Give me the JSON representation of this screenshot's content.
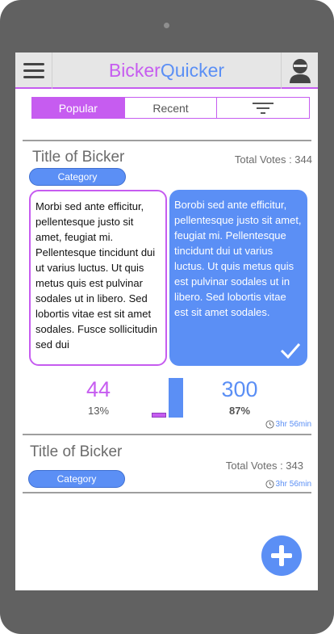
{
  "app": {
    "title_part1": "Bicker",
    "title_part2": "Quicker",
    "icons": {
      "menu": "hamburger-menu-icon",
      "profile": "user-avatar-icon",
      "filter": "filter-icon",
      "add": "plus-icon",
      "check": "checkmark-icon",
      "clock": "clock-icon"
    },
    "colors": {
      "purple": "#c65cf0",
      "blue": "#5b8ff5"
    }
  },
  "tabs": [
    {
      "label": "Popular",
      "active": true
    },
    {
      "label": "Recent",
      "active": false
    }
  ],
  "bickers": [
    {
      "title": "Title of Bicker",
      "category": "Category",
      "total_votes": "Total Votes : 344",
      "left_text": "Morbi sed ante efficitur, pellentesque justo sit amet, feugiat mi. Pellentesque tincidunt dui ut varius luctus. Ut quis metus quis est pulvinar sodales ut in libero. Sed lobortis vitae est sit amet sodales. Fusce sollicitudin sed dui",
      "right_text": "Borobi sed ante efficitur, pellentesque justo sit amet, feugiat mi. Pellentesque tincidunt dui ut varius luctus. Ut quis metus quis est pulvinar sodales ut in libero. Sed lobortis vitae est sit amet sodales.",
      "left_count": "44",
      "left_percent": "13%",
      "right_count": "300",
      "right_percent": "87%",
      "left_share": 0.13,
      "right_share": 0.87,
      "selected_side": "right",
      "time_left": "3hr 56min"
    },
    {
      "title": "Title of Bicker",
      "category": "Category",
      "total_votes": "Total Votes : 343",
      "time_left": "3hr 56min"
    }
  ]
}
